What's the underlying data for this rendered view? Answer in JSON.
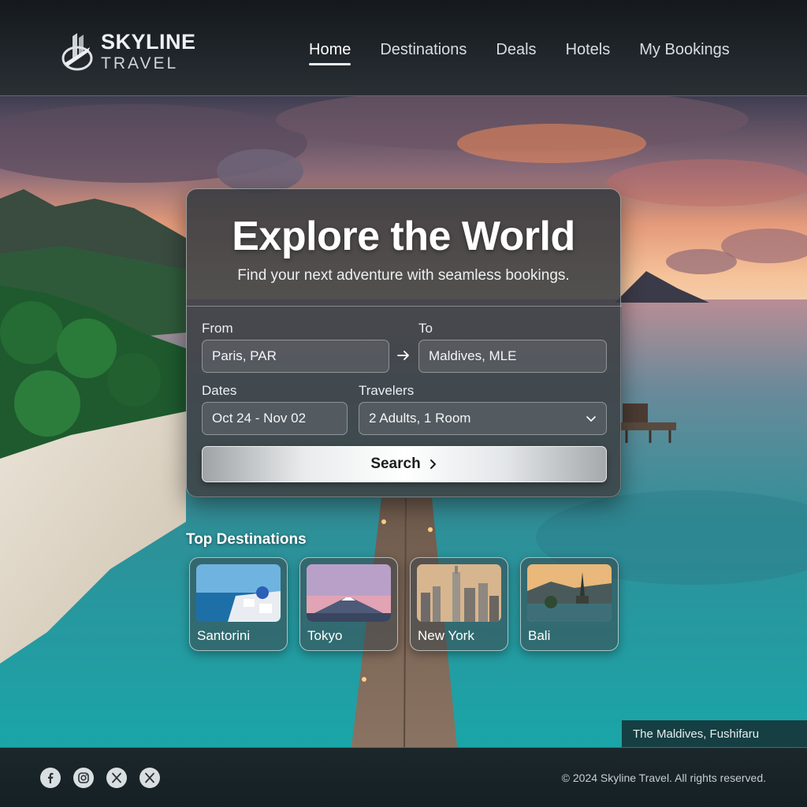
{
  "brand": {
    "name": "SKYLINE",
    "sub": "TRAVEL"
  },
  "nav": [
    {
      "label": "Home",
      "active": true
    },
    {
      "label": "Destinations",
      "active": false
    },
    {
      "label": "Deals",
      "active": false
    },
    {
      "label": "Hotels",
      "active": false
    },
    {
      "label": "My Bookings",
      "active": false
    }
  ],
  "hero": {
    "title": "Explore the World",
    "subtitle": "Find your next adventure with seamless bookings."
  },
  "search": {
    "from_label": "From",
    "from_value": "Paris, PAR",
    "to_label": "To",
    "to_value": "Maldives, MLE",
    "dates_label": "Dates",
    "dates_value": "Oct 24 - Nov 02",
    "travelers_label": "Travelers",
    "travelers_value": "2 Adults, 1 Room",
    "button_label": "Search"
  },
  "top_destinations": {
    "title": "Top Destinations",
    "items": [
      {
        "name": "Santorini"
      },
      {
        "name": "Tokyo"
      },
      {
        "name": "New York"
      },
      {
        "name": "Bali"
      }
    ]
  },
  "caption": "The Maldives, Fushifaru",
  "footer": {
    "social": [
      "facebook-icon",
      "instagram-icon",
      "x-icon",
      "x-icon"
    ],
    "copyright": "© 2024 Skyline Travel. All rights reserved."
  },
  "colors": {
    "header_bg": "#1f252a",
    "ocean": "#2fa3a6",
    "sunset": "#f08a5a",
    "footer_bg": "#172226"
  }
}
